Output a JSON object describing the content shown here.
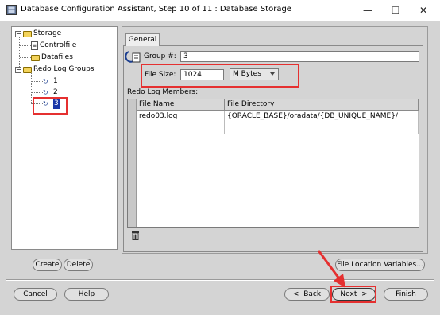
{
  "window": {
    "title": "Database Configuration Assistant, Step 10 of 11 : Database Storage",
    "minimize_glyph": "—",
    "maximize_glyph": "☐",
    "close_glyph": "✕"
  },
  "tree": {
    "root_label": "Storage",
    "items": [
      {
        "label": "Controlfile",
        "icon": "file-icon"
      },
      {
        "label": "Datafiles",
        "icon": "folder-icon"
      },
      {
        "label": "Redo Log Groups",
        "icon": "folder-icon"
      },
      {
        "label": "1",
        "icon": "log-group-icon"
      },
      {
        "label": "2",
        "icon": "log-group-icon"
      },
      {
        "label": "3",
        "icon": "log-group-icon",
        "selected": true
      }
    ]
  },
  "tabs": [
    {
      "label": "General",
      "active": true
    }
  ],
  "form": {
    "group_label": "Group #:",
    "group_value": "3",
    "file_size_label": "File Size:",
    "file_size_value": "1024",
    "size_unit": "M Bytes",
    "members_label": "Redo Log Members:"
  },
  "table": {
    "columns": [
      "File Name",
      "File Directory"
    ],
    "rows": [
      [
        "redo03.log",
        "{ORACLE_BASE}/oradata/{DB_UNIQUE_NAME}/"
      ],
      [
        "",
        ""
      ]
    ]
  },
  "buttons": {
    "create": "Create",
    "delete": "Delete",
    "file_location_variables": "File Location Variables...",
    "cancel": "Cancel",
    "help": "Help",
    "back_mnemonic": "B",
    "back_rest": "ack",
    "next_mnemonic": "N",
    "next_rest": "ext",
    "finish_mnemonic": "F",
    "finish_rest": "inish"
  },
  "colors": {
    "highlight": "#e53030",
    "selection": "#1a36a8",
    "panel_bg": "#d4d4d4"
  }
}
